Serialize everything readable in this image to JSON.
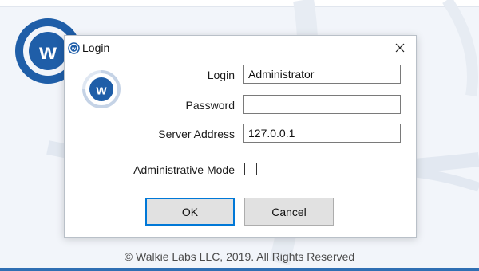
{
  "app": {
    "copyright": "© Walkie Labs LLC, 2019. All Rights Reserved",
    "brand_color": "#1f5ea8",
    "logo_icon": "walkie-labs-logo"
  },
  "dialog": {
    "title": "Login",
    "close_icon": "close-icon",
    "fields": {
      "login": {
        "label": "Login",
        "value": "Administrator"
      },
      "password": {
        "label": "Password",
        "value": ""
      },
      "server_address": {
        "label": "Server Address",
        "value": "127.0.0.1"
      }
    },
    "admin_mode": {
      "label": "Administrative Mode",
      "checked": false
    },
    "buttons": {
      "ok": "OK",
      "cancel": "Cancel"
    },
    "accent_color": "#0078d7"
  }
}
